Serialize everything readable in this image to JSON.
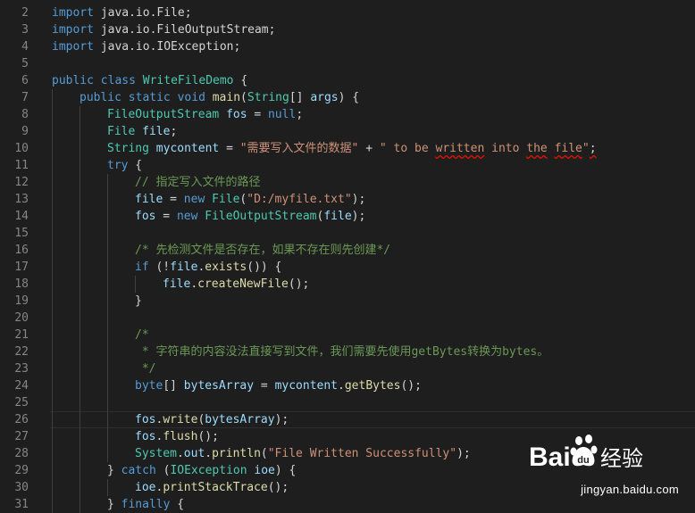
{
  "editor": {
    "lines": [
      {
        "n": "2",
        "indent": 0,
        "tokens": [
          [
            "kw",
            "import"
          ],
          [
            "pl",
            " java.io.File;"
          ]
        ]
      },
      {
        "n": "3",
        "indent": 0,
        "tokens": [
          [
            "kw",
            "import"
          ],
          [
            "pl",
            " java.io.FileOutputStream;"
          ]
        ]
      },
      {
        "n": "4",
        "indent": 0,
        "tokens": [
          [
            "kw",
            "import"
          ],
          [
            "pl",
            " java.io.IOException;"
          ]
        ]
      },
      {
        "n": "5",
        "indent": 0,
        "tokens": []
      },
      {
        "n": "6",
        "indent": 0,
        "tokens": [
          [
            "kw",
            "public"
          ],
          [
            "pl",
            " "
          ],
          [
            "kw",
            "class"
          ],
          [
            "pl",
            " "
          ],
          [
            "ty",
            "WriteFileDemo"
          ],
          [
            "pl",
            " {"
          ]
        ]
      },
      {
        "n": "7",
        "indent": 1,
        "tokens": [
          [
            "kw",
            "public"
          ],
          [
            "pl",
            " "
          ],
          [
            "kw",
            "static"
          ],
          [
            "pl",
            " "
          ],
          [
            "kw",
            "void"
          ],
          [
            "pl",
            " "
          ],
          [
            "fn",
            "main"
          ],
          [
            "pl",
            "("
          ],
          [
            "ty",
            "String"
          ],
          [
            "pl",
            "[] "
          ],
          [
            "var",
            "args"
          ],
          [
            "pl",
            ") {"
          ]
        ]
      },
      {
        "n": "8",
        "indent": 2,
        "tokens": [
          [
            "ty",
            "FileOutputStream"
          ],
          [
            "pl",
            " "
          ],
          [
            "var",
            "fos"
          ],
          [
            "pl",
            " = "
          ],
          [
            "kw",
            "null"
          ],
          [
            "pl",
            ";"
          ]
        ]
      },
      {
        "n": "9",
        "indent": 2,
        "tokens": [
          [
            "ty",
            "File"
          ],
          [
            "pl",
            " "
          ],
          [
            "var",
            "file"
          ],
          [
            "pl",
            ";"
          ]
        ]
      },
      {
        "n": "10",
        "indent": 2,
        "tokens": [
          [
            "ty",
            "String"
          ],
          [
            "pl",
            " "
          ],
          [
            "var",
            "mycontent"
          ],
          [
            "pl",
            " = "
          ],
          [
            "str",
            "\"需要写入文件的数据\""
          ],
          [
            "pl",
            " + "
          ],
          [
            "str",
            "\" to be "
          ],
          [
            "str sq",
            "written"
          ],
          [
            "str",
            " into "
          ],
          [
            "str sq",
            "the"
          ],
          [
            "str",
            " "
          ],
          [
            "str sq",
            "file"
          ],
          [
            "str",
            "\""
          ],
          [
            "pl sq",
            ";"
          ]
        ]
      },
      {
        "n": "11",
        "indent": 2,
        "tokens": [
          [
            "kw",
            "try"
          ],
          [
            "pl",
            " {"
          ]
        ]
      },
      {
        "n": "12",
        "indent": 3,
        "tokens": [
          [
            "cmt",
            "// 指定写入文件的路径"
          ]
        ]
      },
      {
        "n": "13",
        "indent": 3,
        "tokens": [
          [
            "var",
            "file"
          ],
          [
            "pl",
            " = "
          ],
          [
            "kw",
            "new"
          ],
          [
            "pl",
            " "
          ],
          [
            "ty",
            "File"
          ],
          [
            "pl",
            "("
          ],
          [
            "str",
            "\"D:/myfile.txt\""
          ],
          [
            "pl",
            ");"
          ]
        ]
      },
      {
        "n": "14",
        "indent": 3,
        "tokens": [
          [
            "var",
            "fos"
          ],
          [
            "pl",
            " = "
          ],
          [
            "kw",
            "new"
          ],
          [
            "pl",
            " "
          ],
          [
            "ty",
            "FileOutputStream"
          ],
          [
            "pl",
            "("
          ],
          [
            "var",
            "file"
          ],
          [
            "pl",
            ");"
          ]
        ]
      },
      {
        "n": "15",
        "indent": 3,
        "tokens": []
      },
      {
        "n": "16",
        "indent": 3,
        "tokens": [
          [
            "cmt",
            "/* 先检测文件是否存在，如果不存在则先创建*/"
          ]
        ]
      },
      {
        "n": "17",
        "indent": 3,
        "tokens": [
          [
            "kw",
            "if"
          ],
          [
            "pl",
            " (!"
          ],
          [
            "var",
            "file"
          ],
          [
            "pl",
            "."
          ],
          [
            "fn",
            "exists"
          ],
          [
            "pl",
            "()) {"
          ]
        ]
      },
      {
        "n": "18",
        "indent": 4,
        "tokens": [
          [
            "var",
            "file"
          ],
          [
            "pl",
            "."
          ],
          [
            "fn",
            "createNewFile"
          ],
          [
            "pl",
            "();"
          ]
        ]
      },
      {
        "n": "19",
        "indent": 3,
        "tokens": [
          [
            "pl",
            "}"
          ]
        ]
      },
      {
        "n": "20",
        "indent": 3,
        "tokens": []
      },
      {
        "n": "21",
        "indent": 3,
        "tokens": [
          [
            "cmt",
            "/*"
          ]
        ]
      },
      {
        "n": "22",
        "indent": 3,
        "tokens": [
          [
            "cmt",
            " * 字符串的内容没法直接写到文件，我们需要先使用getBytes转换为bytes。"
          ]
        ]
      },
      {
        "n": "23",
        "indent": 3,
        "tokens": [
          [
            "cmt",
            " */"
          ]
        ]
      },
      {
        "n": "24",
        "indent": 3,
        "tokens": [
          [
            "kw",
            "byte"
          ],
          [
            "pl",
            "[] "
          ],
          [
            "var",
            "bytesArray"
          ],
          [
            "pl",
            " = "
          ],
          [
            "var",
            "mycontent"
          ],
          [
            "pl",
            "."
          ],
          [
            "fn",
            "getBytes"
          ],
          [
            "pl",
            "();"
          ]
        ]
      },
      {
        "n": "25",
        "indent": 3,
        "tokens": []
      },
      {
        "n": "26",
        "indent": 3,
        "current": true,
        "tokens": [
          [
            "var",
            "fos"
          ],
          [
            "pl",
            "."
          ],
          [
            "fn",
            "write"
          ],
          [
            "pl",
            "("
          ],
          [
            "var",
            "bytesArray"
          ],
          [
            "pl",
            ");"
          ]
        ]
      },
      {
        "n": "27",
        "indent": 3,
        "tokens": [
          [
            "var",
            "fos"
          ],
          [
            "pl",
            "."
          ],
          [
            "fn",
            "flush"
          ],
          [
            "pl",
            "();"
          ]
        ]
      },
      {
        "n": "28",
        "indent": 3,
        "tokens": [
          [
            "ty",
            "System"
          ],
          [
            "pl",
            "."
          ],
          [
            "var",
            "out"
          ],
          [
            "pl",
            "."
          ],
          [
            "fn",
            "println"
          ],
          [
            "pl",
            "("
          ],
          [
            "str",
            "\"File Written Successfully\""
          ],
          [
            "pl",
            ");"
          ]
        ]
      },
      {
        "n": "29",
        "indent": 2,
        "tokens": [
          [
            "pl",
            "} "
          ],
          [
            "kw",
            "catch"
          ],
          [
            "pl",
            " ("
          ],
          [
            "ty",
            "IOException"
          ],
          [
            "pl",
            " "
          ],
          [
            "var",
            "ioe"
          ],
          [
            "pl",
            ") {"
          ]
        ]
      },
      {
        "n": "30",
        "indent": 3,
        "tokens": [
          [
            "var",
            "ioe"
          ],
          [
            "pl",
            "."
          ],
          [
            "fn",
            "printStackTrace"
          ],
          [
            "pl",
            "();"
          ]
        ]
      },
      {
        "n": "31",
        "indent": 2,
        "tokens": [
          [
            "pl",
            "} "
          ],
          [
            "kw",
            "finally"
          ],
          [
            "pl",
            " {"
          ]
        ]
      }
    ]
  },
  "watermark": {
    "brand": "Bai du 经验",
    "url": "jingyan.baidu.com"
  }
}
